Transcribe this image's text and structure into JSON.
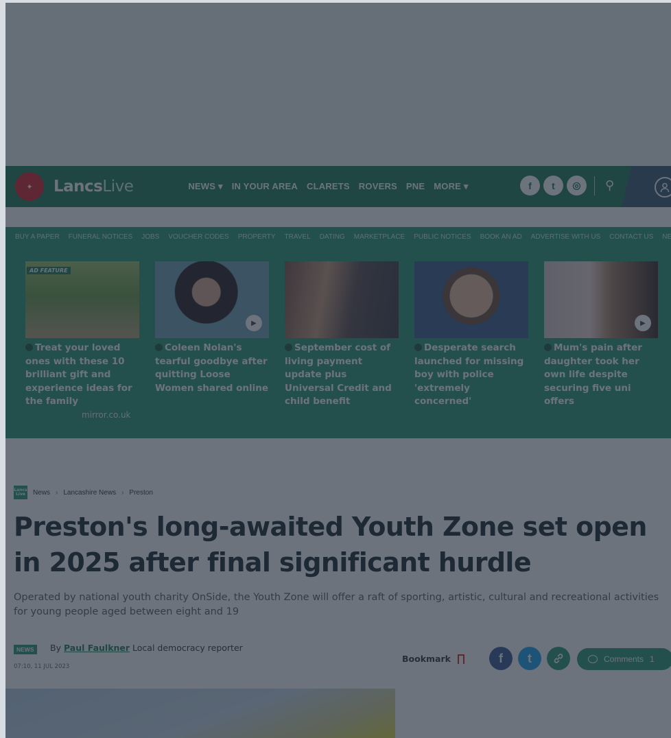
{
  "brand": {
    "logo_text_bold": "Lancs",
    "logo_text_light": "Live",
    "logo_mark": "✦"
  },
  "main_nav": [
    "NEWS ▾",
    "IN YOUR AREA",
    "CLARETS",
    "ROVERS",
    "PNE",
    "MORE ▾"
  ],
  "social": {
    "facebook": "f",
    "twitter": "t",
    "instagram": "◎",
    "search": "⚲",
    "account": "◯"
  },
  "sub_nav": [
    "BUY A PAPER",
    "FUNERAL NOTICES",
    "JOBS",
    "VOUCHER CODES",
    "PROPERTY",
    "TRAVEL",
    "DATING",
    "MARKETPLACE",
    "PUBLIC NOTICES",
    "BOOK AN AD",
    "ADVERTISE WITH US",
    "CONTACT US",
    "NEWSLETTERS"
  ],
  "teasers": [
    {
      "title": "Treat your loved ones with these 10 brilliant gift and experience ideas for the family",
      "tag": "AD FEATURE",
      "sponsor": "mirror.co.uk",
      "video": false
    },
    {
      "title": "Coleen Nolan's tearful goodbye after quitting Loose Women shared online",
      "video": true
    },
    {
      "title": "September cost of living payment update plus Universal Credit and child benefit",
      "video": false
    },
    {
      "title": "Desperate search launched for missing boy with police 'extremely concerned'",
      "video": false
    },
    {
      "title": "Mum's pain after daughter took her own life despite securing five uni offers",
      "video": true
    }
  ],
  "breadcrumb": {
    "logo": "Lancs Live",
    "items": [
      "News",
      "Lancashire News",
      "Preston"
    ],
    "separator": "›"
  },
  "article": {
    "headline": "Preston's long-awaited Youth Zone set open in 2025 after final significant hurdle",
    "standfirst": "Operated by national youth charity OnSide, the Youth Zone will offer a raft of sporting, artistic, cultural and recreational activities for young people aged between eight and 19",
    "category": "NEWS",
    "by_prefix": "By",
    "author": "Paul Faulkner",
    "author_role": "Local democracy reporter",
    "date": "07:10, 11 JUL 2023",
    "bookmark_label": "Bookmark",
    "comments_label": "Comments",
    "comments_count": "1"
  },
  "colors": {
    "brand_green": "#1f7b58",
    "accent_green": "#2a9a72",
    "brand_red": "#d8202a",
    "facebook": "#3b5998",
    "twitter": "#1da1f2",
    "overlay": "rgba(32,42,56,0.66)"
  }
}
